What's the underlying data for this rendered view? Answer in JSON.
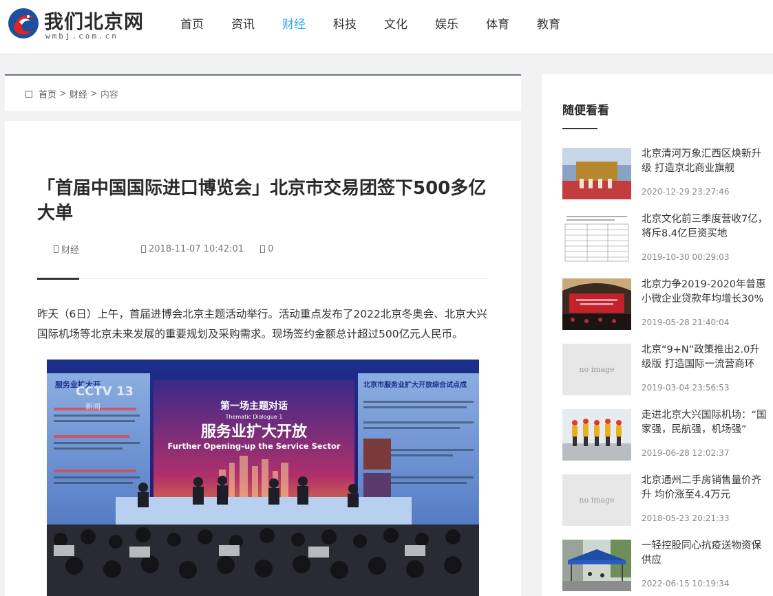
{
  "site": {
    "logo_text": "我们北京网",
    "logo_sub": "wmbj.com.cn"
  },
  "nav": {
    "items": [
      {
        "label": "首页",
        "active": false
      },
      {
        "label": "资讯",
        "active": false
      },
      {
        "label": "财经",
        "active": true
      },
      {
        "label": "科技",
        "active": false
      },
      {
        "label": "文化",
        "active": false
      },
      {
        "label": "娱乐",
        "active": false
      },
      {
        "label": "体育",
        "active": false
      },
      {
        "label": "教育",
        "active": false
      }
    ],
    "active_color": "#2ba8e6"
  },
  "breadcrumb": {
    "home": "首页",
    "sep": ">",
    "category": "财经",
    "current": "内容",
    "home_icon": "home-icon"
  },
  "article": {
    "title": "「首届中国国际进口博览会」北京市交易团签下500多亿大单",
    "category": "财经",
    "datetime": "2018-11-07 10:42:01",
    "comments": "0",
    "lead": "昨天（6日）上午，首届进博会北京主题活动举行。活动重点发布了2022北京冬奥会、北京大兴国际机场等北京未来发展的重要规划及采购需求。现场签约金额总计超过500亿元人民币。",
    "photo": {
      "stage_title_cn": "服务业扩大开放",
      "stage_title_en": "Further Opening-up the Service Sector",
      "stage_sub_cn": "第一场主题对话",
      "stage_sub_en": "Thematic Dialogue 1",
      "left_panel_cn": "服务业扩大开",
      "right_panel_cn": "北京市服务业扩大开放综合试点成",
      "watermark": "CCTV 13",
      "watermark_sub": "新闻"
    }
  },
  "sidebar": {
    "title": "随便看看",
    "no_image_label": "no image",
    "items": [
      {
        "headline": "北京清河万象汇西区焕新升级 打造京北商业旗舰",
        "date": "2020-12-29 23:27:46",
        "thumb": "mall"
      },
      {
        "headline": "北京文化前三季度营收7亿，将斥8.4亿巨资买地",
        "date": "2019-10-30 00:29:03",
        "thumb": "table"
      },
      {
        "headline": "北京力争2019-2020年普惠小微企业贷款年均增长30%",
        "date": "2019-05-28 21:40:04",
        "thumb": "conference"
      },
      {
        "headline": "北京“9+N”政策推出2.0升级版 打造国际一流营商环境…",
        "date": "2019-03-04 23:56:53",
        "thumb": "noimage"
      },
      {
        "headline": "走进北京大兴国际机场：“国家强，民航强，机场强”",
        "date": "2019-06-28 12:02:37",
        "thumb": "workers"
      },
      {
        "headline": "北京通州二手房销售量价齐升 均价涨至4.4万元",
        "date": "2018-05-23 20:21:33",
        "thumb": "noimage"
      },
      {
        "headline": "一轻控股同心抗疫送物资保供应",
        "date": "2022-06-15 10:19:34",
        "thumb": "tent"
      }
    ]
  }
}
